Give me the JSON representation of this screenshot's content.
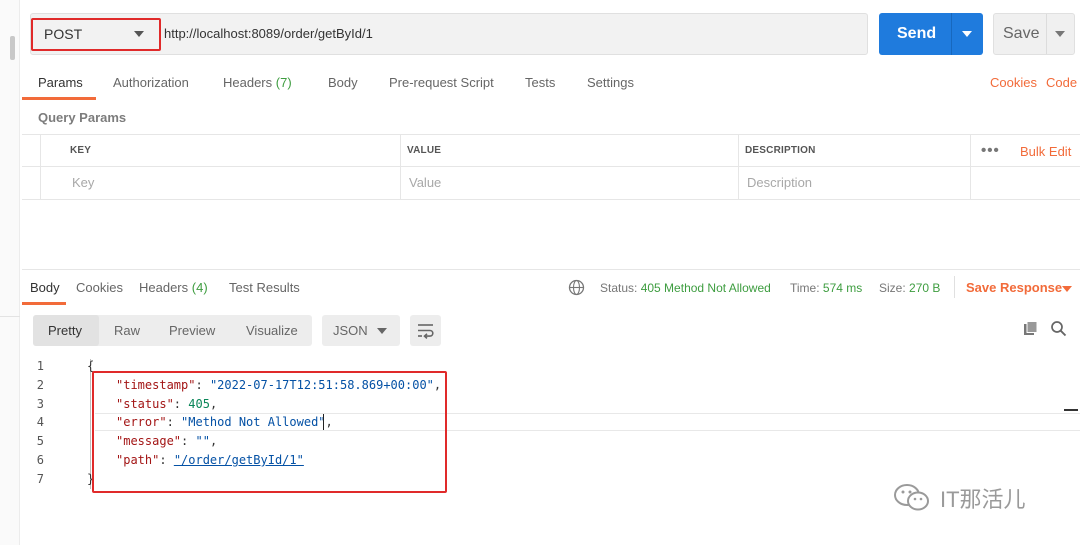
{
  "request": {
    "method": "POST",
    "url": "http://localhost:8089/order/getById/1",
    "send_label": "Send",
    "save_label": "Save"
  },
  "request_tabs": {
    "params": "Params",
    "authorization": "Authorization",
    "headers": "Headers",
    "headers_count": "(7)",
    "body": "Body",
    "prerequest": "Pre-request Script",
    "tests": "Tests",
    "settings": "Settings",
    "cookies": "Cookies",
    "code": "Code"
  },
  "query_params": {
    "title": "Query Params",
    "col_key": "KEY",
    "col_value": "VALUE",
    "col_description": "DESCRIPTION",
    "more": "•••",
    "bulk_edit": "Bulk Edit",
    "key_placeholder": "Key",
    "value_placeholder": "Value",
    "description_placeholder": "Description"
  },
  "response_tabs": {
    "body": "Body",
    "cookies": "Cookies",
    "headers": "Headers",
    "headers_count": "(4)",
    "test_results": "Test Results"
  },
  "response_status": {
    "status_label": "Status:",
    "status_value": "405 Method Not Allowed",
    "time_label": "Time:",
    "time_value": "574 ms",
    "size_label": "Size:",
    "size_value": "270 B",
    "save_response": "Save Response"
  },
  "viewer": {
    "pretty": "Pretty",
    "raw": "Raw",
    "preview": "Preview",
    "visualize": "Visualize",
    "format": "JSON"
  },
  "code": {
    "line_numbers": [
      "1",
      "2",
      "3",
      "4",
      "5",
      "6",
      "7"
    ],
    "open_brace": "{",
    "close_brace": "}",
    "timestamp_key": "\"timestamp\"",
    "timestamp_value": "\"2022-07-17T12:51:58.869+00:00\"",
    "status_key": "\"status\"",
    "status_value": "405",
    "error_key": "\"error\"",
    "error_value": "\"Method Not Allowed\"",
    "message_key": "\"message\"",
    "message_value": "\"\"",
    "path_key": "\"path\"",
    "path_value": "\"/order/getById/1\""
  },
  "watermark": {
    "text": "IT那活儿"
  },
  "colors": {
    "accent_orange": "#f26b3a",
    "send_blue": "#1f7bdd",
    "status_green": "#3e9d40",
    "highlight_red": "#e02a2a"
  }
}
